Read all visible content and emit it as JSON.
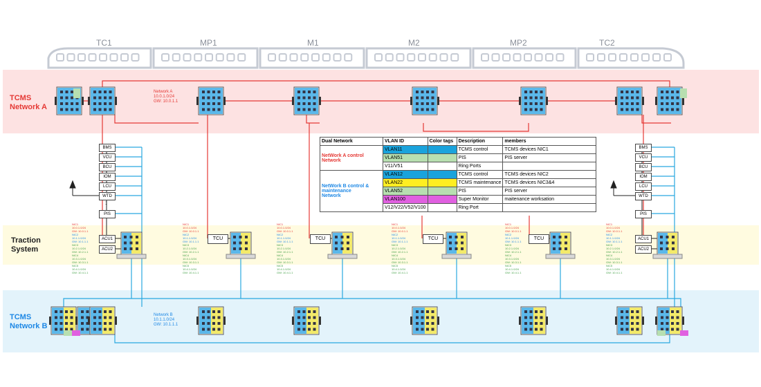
{
  "cars": [
    "TC1",
    "MP1",
    "M1",
    "M2",
    "MP2",
    "TC2"
  ],
  "bands": {
    "network_a": "TCMS\nNetwork A",
    "traction": "Traction\nSystem",
    "network_b": "TCMS\nNetwork B"
  },
  "network_a_info": [
    "Network A",
    "10.0.1.0/24",
    "GW: 10.0.1.1"
  ],
  "network_b_info": [
    "Network B",
    "10.1.1.0/24",
    "GW: 10.1.1.1"
  ],
  "tc_devices": [
    "BMS",
    "VCU",
    "BCU",
    "IOM",
    "LCU",
    "WTD",
    "PIS"
  ],
  "acu_labels": [
    "ACU1",
    "ACU2"
  ],
  "tcu_label": "TCU",
  "dots": ":",
  "nic_lines": [
    "NIC1",
    "10.0.1.0/24",
    "GW: 10.0.1.1",
    "NIC2",
    "10.1.1.0/24",
    "GW: 10.1.1.1",
    "NIC3",
    "10.2.1.0/24",
    "GW: 10.2.1.1",
    "NIC4",
    "10.3.1.0/24",
    "GW: 10.3.1.1",
    "NIC5",
    "10.4.1.0/24",
    "GW: 10.4.1.1"
  ],
  "vlan_table": {
    "headers": [
      "Dual Network",
      "VLAN ID",
      "Color tags",
      "Description",
      "members"
    ],
    "group_a": "NetWork A control\nNetwork",
    "group_b": "NetWork B control &\nmaintenance\nNetwork",
    "rows": [
      {
        "vlan": "VLAN11",
        "color": "#1aa3dc",
        "desc": "TCMS control",
        "members": "TCMS devices NIC1"
      },
      {
        "vlan": "VLAN51",
        "color": "#b7dfb0",
        "desc": "PIS",
        "members": "PIS server"
      },
      {
        "vlan": "V11/V51",
        "color": "",
        "desc": "Ring Ports",
        "members": ""
      },
      {
        "vlan": "VLAN12",
        "color": "#1aa3dc",
        "desc": "TCMS control",
        "members": "TCMS devices NIC2"
      },
      {
        "vlan": "VLAN22",
        "color": "#ffee22",
        "desc": "TCMS maintenance",
        "members": "TCMS devices NIC3&4"
      },
      {
        "vlan": "VLAN52",
        "color": "#b7dfb0",
        "desc": "PIS",
        "members": "PIS server"
      },
      {
        "vlan": "VLAN100",
        "color": "#e060e0",
        "desc": "Super Monitor",
        "members": "maitenance worksation"
      },
      {
        "vlan": "V12/V22/V52/V100",
        "color": "",
        "desc": "Ring Port",
        "members": ""
      }
    ]
  },
  "colors": {
    "network_a_line": "#e53935",
    "network_b_line": "#29a8e0",
    "band_a": "#fde2e2",
    "band_traction": "#fffbe0",
    "band_b": "#e3f3fb",
    "switch_blue": "#5bb8ea",
    "switch_yellow": "#f3ea6a",
    "train_outline": "#c5cad3"
  }
}
